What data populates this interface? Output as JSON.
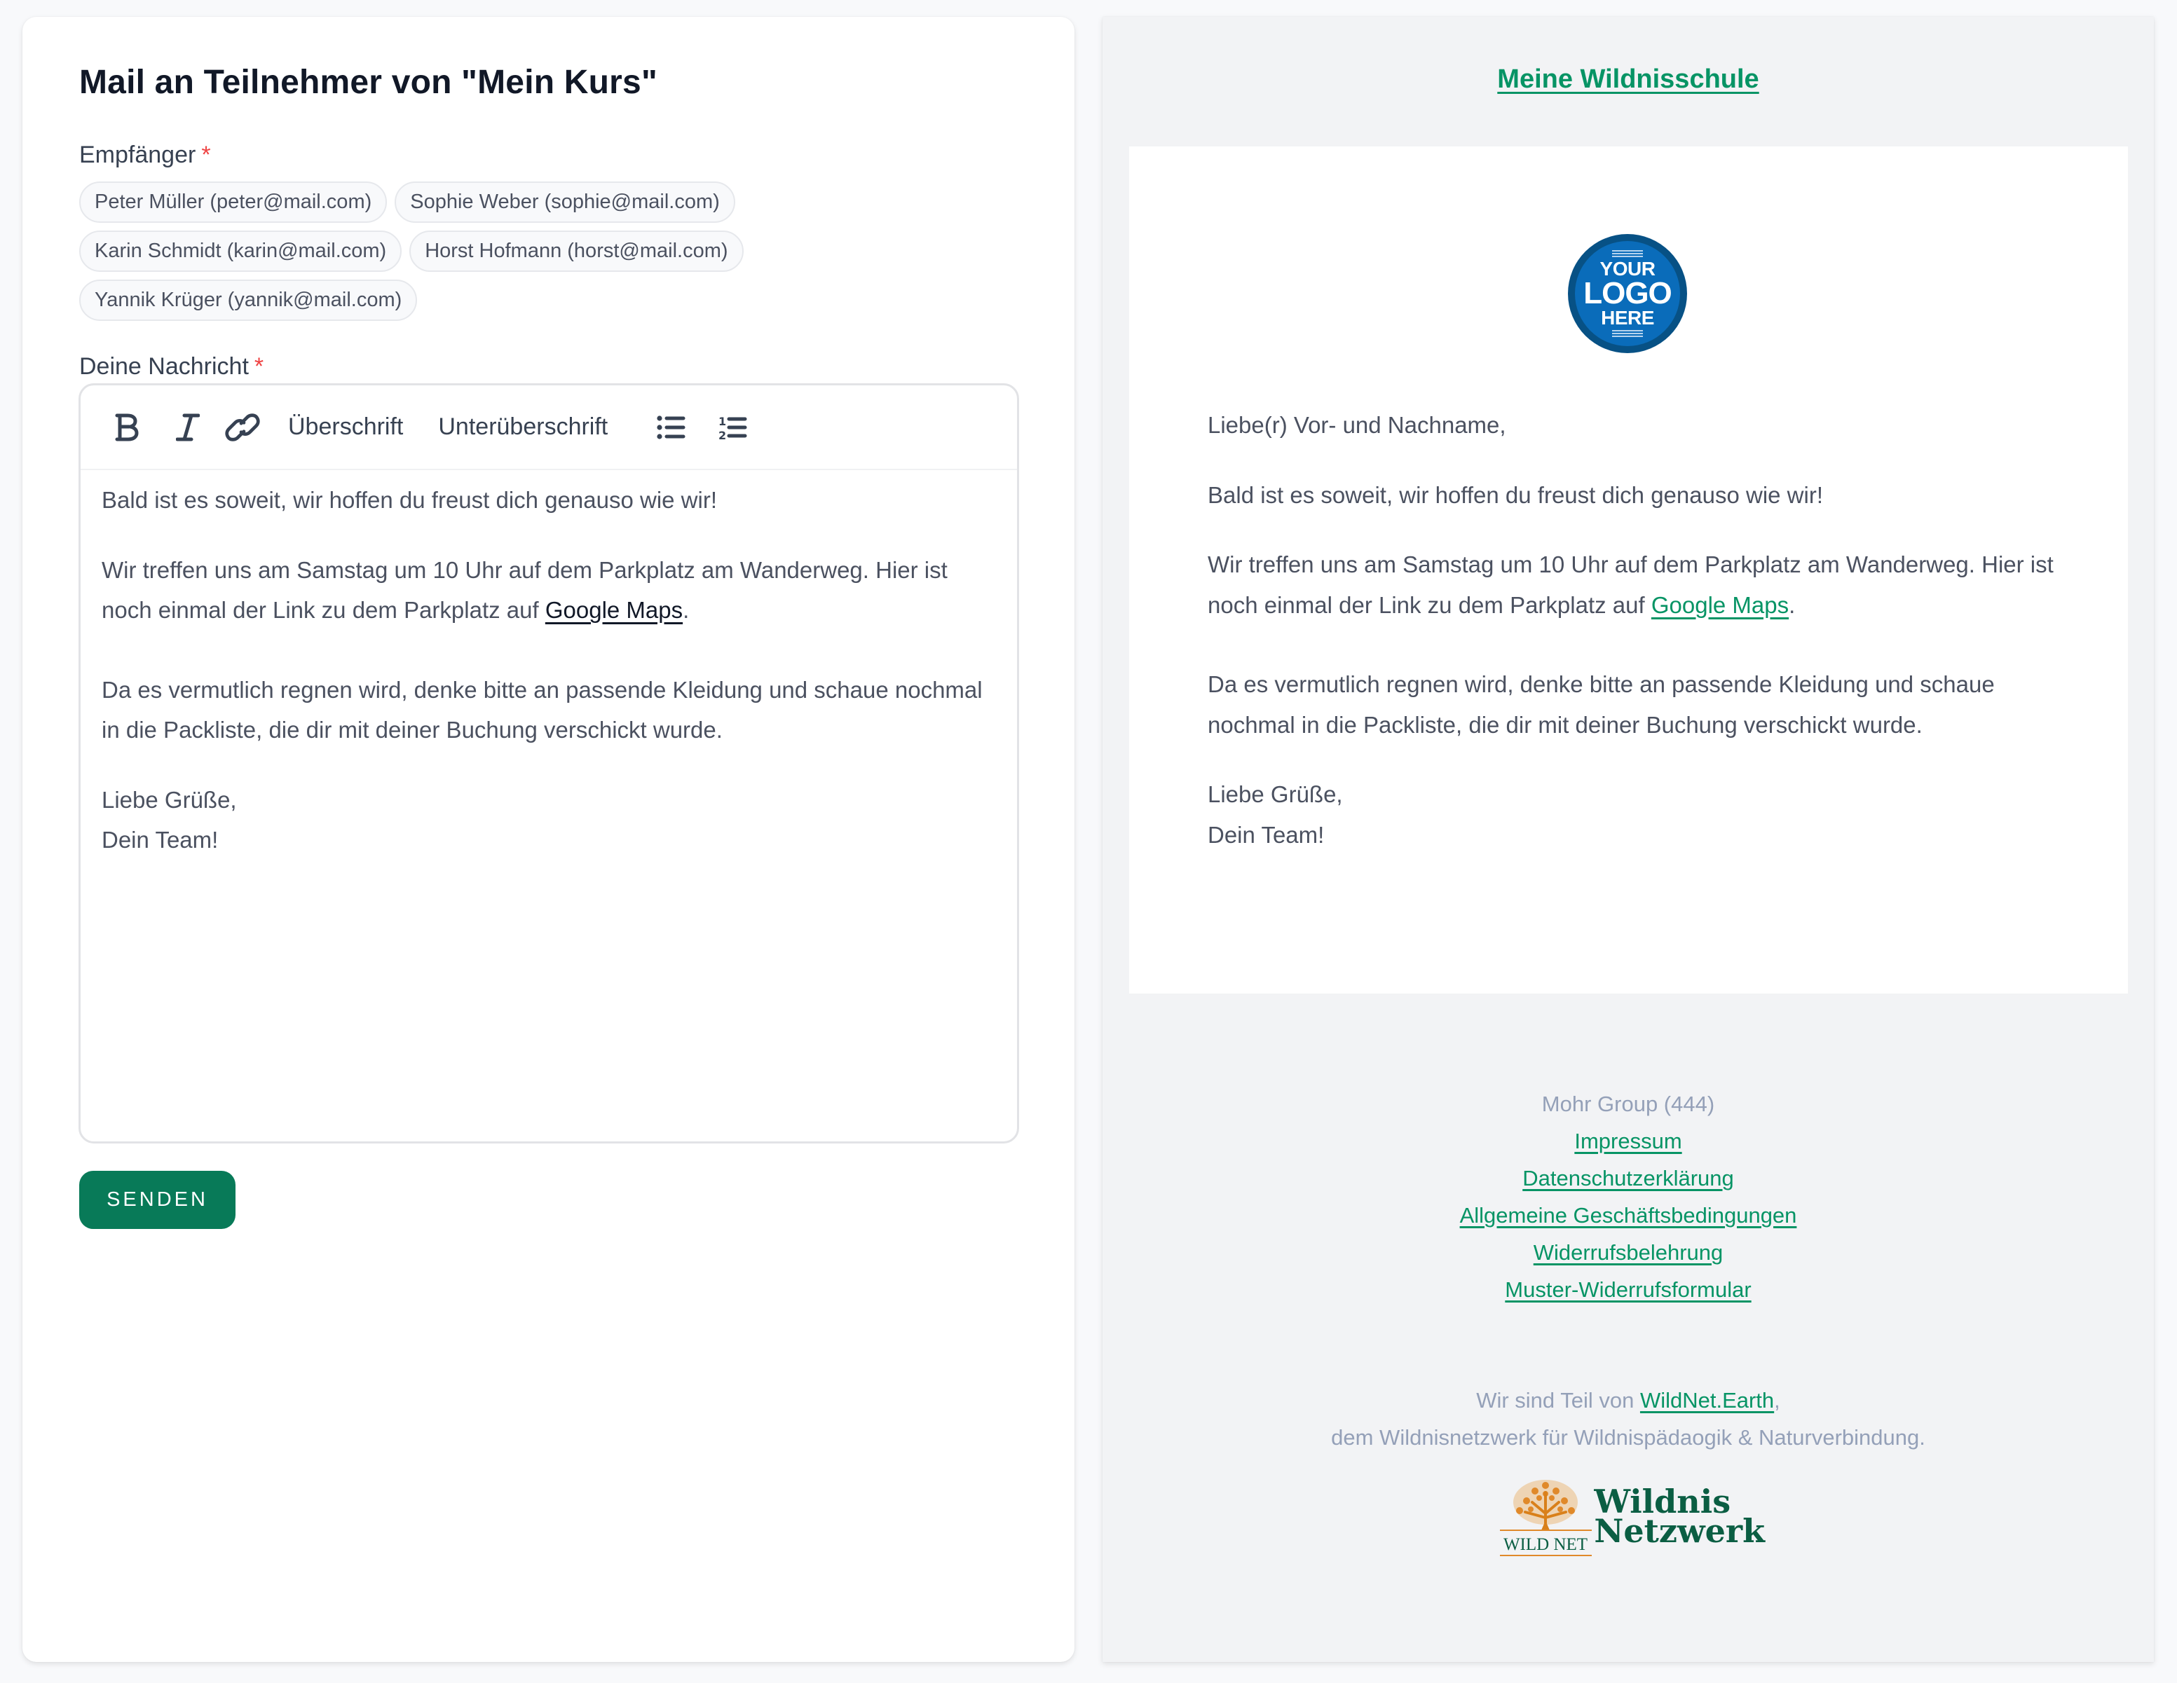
{
  "compose": {
    "title": "Mail an Teilnehmer von \"Mein Kurs\"",
    "recipients_label": "Empfänger",
    "required_marker": "*",
    "recipients": [
      "Peter Müller (peter@mail.com)",
      "Sophie Weber (sophie@mail.com)",
      "Karin Schmidt (karin@mail.com)",
      "Horst Hofmann (horst@mail.com)",
      "Yannik Krüger (yannik@mail.com)"
    ],
    "message_label": "Deine Nachricht",
    "toolbar": {
      "bold_icon": "bold-icon",
      "italic_icon": "italic-icon",
      "link_icon": "link-icon",
      "heading_label": "Überschrift",
      "subheading_label": "Unterüberschrift",
      "bullet_list_icon": "bullet-list-icon",
      "numbered_list_icon": "numbered-list-icon"
    },
    "message": {
      "p1": "Bald ist es soweit, wir hoffen du freust dich genauso wie wir!",
      "p2_before_link": "Wir treffen uns am Samstag um 10 Uhr auf dem Parkplatz am Wanderweg. Hier ist noch einmal der Link zu dem Parkplatz auf ",
      "p2_link": "Google Maps",
      "p2_after_link": ".",
      "p3": "Da es vermutlich regnen wird, denke bitte an passende Kleidung und schaue nochmal in die Packliste, die dir mit deiner Buchung verschickt wurde.",
      "p4_line1": "Liebe Grüße,",
      "p4_line2": "Dein Team!"
    },
    "send_label": "SENDEN",
    "colors": {
      "send_button": "#087a58",
      "required": "#ef4444"
    }
  },
  "preview": {
    "school_name": "Meine Wildnisschule",
    "logo": {
      "line1": "YOUR",
      "line2": "LOGO",
      "line3": "HERE"
    },
    "greeting": "Liebe(r) Vor- und Nachname,",
    "p1": "Bald ist es soweit, wir hoffen du freust dich genauso wie wir!",
    "p2_before_link": "Wir treffen uns am Samstag um 10 Uhr auf dem Parkplatz am Wanderweg. Hier ist noch einmal der Link zu dem Parkplatz auf ",
    "p2_link": "Google Maps",
    "p2_after_link": ".",
    "p3": "Da es vermutlich regnen wird, denke bitte an passende Kleidung und schaue nochmal in die Packliste, die dir mit deiner Buchung verschickt wurde.",
    "p4_line1": "Liebe Grüße,",
    "p4_line2": "Dein Team!",
    "footer": {
      "company": "Mohr Group (444)",
      "links": [
        "Impressum",
        "Datenschutzerklärung",
        "Allgemeine Geschäftsbedingungen",
        "Widerrufsbelehrung",
        "Muster-Widerrufsformular"
      ],
      "network_prefix": "Wir sind Teil von ",
      "network_link": "WildNet.Earth",
      "network_suffix": ",",
      "network_line2": "dem Wildnisnetzwerk für Wildnispädaogik & Naturverbindung.",
      "wildnet_emblem_text": "WILD NET",
      "wildnet_word1": "Wildnis",
      "wildnet_word2": "Netzwerk"
    },
    "colors": {
      "link": "#079465",
      "muted": "#94a0b8",
      "logo_blue": "#0a6cba",
      "wildnet_green": "#0b5e43",
      "wildnet_orange": "#d9801a"
    }
  }
}
